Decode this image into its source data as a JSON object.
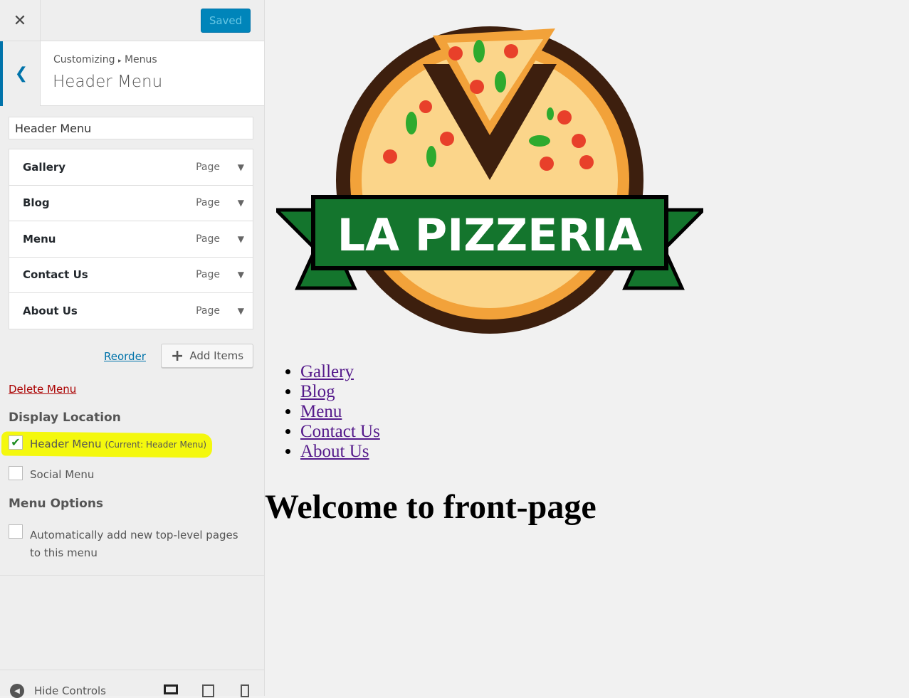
{
  "sidebar": {
    "close_icon": "close-icon",
    "save_label": "Saved",
    "breadcrumb": {
      "root": "Customizing",
      "separator": "▸",
      "current": "Menus"
    },
    "title": "Header Menu",
    "menu_name_value": "Header Menu",
    "items": [
      {
        "label": "Gallery",
        "type": "Page"
      },
      {
        "label": "Blog",
        "type": "Page"
      },
      {
        "label": "Menu",
        "type": "Page"
      },
      {
        "label": "Contact Us",
        "type": "Page"
      },
      {
        "label": "About Us",
        "type": "Page"
      }
    ],
    "reorder_label": "Reorder",
    "add_items_label": "Add Items",
    "delete_label": "Delete Menu",
    "display_location_heading": "Display Location",
    "locations": [
      {
        "label": "Header Menu",
        "note": "(Current: Header Menu)",
        "checked": true
      },
      {
        "label": "Social Menu",
        "note": "",
        "checked": false
      }
    ],
    "menu_options_heading": "Menu Options",
    "auto_add_label": "Automatically add new top-level pages to this menu",
    "auto_add_checked": false,
    "hide_controls_label": "Hide Controls",
    "highlight_color": "#f4f80e",
    "accent_color": "#0073aa"
  },
  "preview": {
    "logo_text": "LA PIZZERIA",
    "nav": [
      "Gallery",
      "Blog",
      "Menu",
      "Contact Us",
      "About Us"
    ],
    "heading": "Welcome to front-page"
  }
}
